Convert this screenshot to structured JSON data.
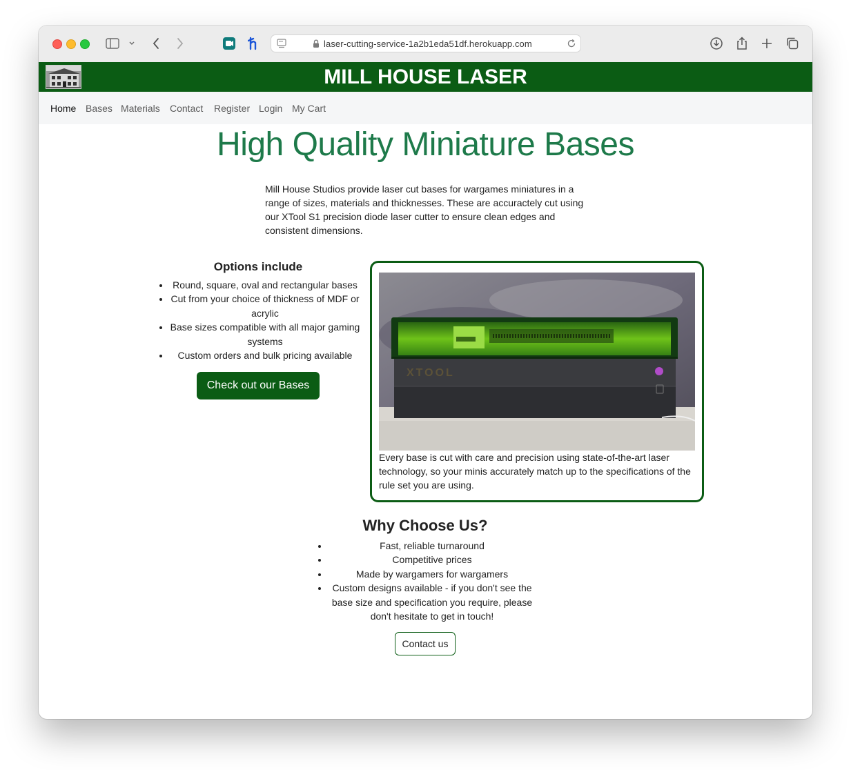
{
  "browser": {
    "url": "laser-cutting-service-1a2b1eda51df.herokuapp.com",
    "icons": [
      "sidebar-icon",
      "chevron-down-icon",
      "back-icon",
      "forward-icon",
      "extension-icon",
      "honey-extension-icon",
      "page-icon",
      "lock-icon",
      "reload-icon",
      "download-icon",
      "share-icon",
      "new-tab-icon",
      "tabs-overview-icon"
    ]
  },
  "header": {
    "title": "MILL HOUSE LASER",
    "brand_color": "#0b5c14"
  },
  "nav": {
    "items": [
      "Home",
      "Bases",
      "Materials",
      "Contact",
      "Register",
      "Login",
      "My Cart"
    ],
    "active": "Home"
  },
  "hero": {
    "title": "High Quality Miniature Bases",
    "title_color": "#1e7a4a",
    "intro": "Mill House Studios provide laser cut bases for wargames miniatures in a range of sizes, materials and thicknesses. These are accuractely cut using our XTool S1 precision diode laser cutter to ensure clean edges and consistent dimensions."
  },
  "options": {
    "heading": "Options include",
    "items": [
      "Round, square, oval and rectangular bases",
      "Cut from your choice of thickness of MDF or acrylic",
      "Base sizes compatible with all major gaming systems",
      "Custom orders and bulk pricing available"
    ],
    "button": "Check out our Bases"
  },
  "card": {
    "image_label": "XTOOL",
    "caption": "Every base is cut with care and precision using state-of-the-art laser technology, so your minis accurately match up to the specifications of the rule set you are using."
  },
  "why": {
    "heading": "Why Choose Us?",
    "items": [
      "Fast, reliable turnaround",
      "Competitive prices",
      "Made by wargamers for wargamers",
      "Custom designs available - if you don't see the base size and specification you require, please don't hesitate to get in touch!"
    ],
    "button": "Contact us"
  }
}
